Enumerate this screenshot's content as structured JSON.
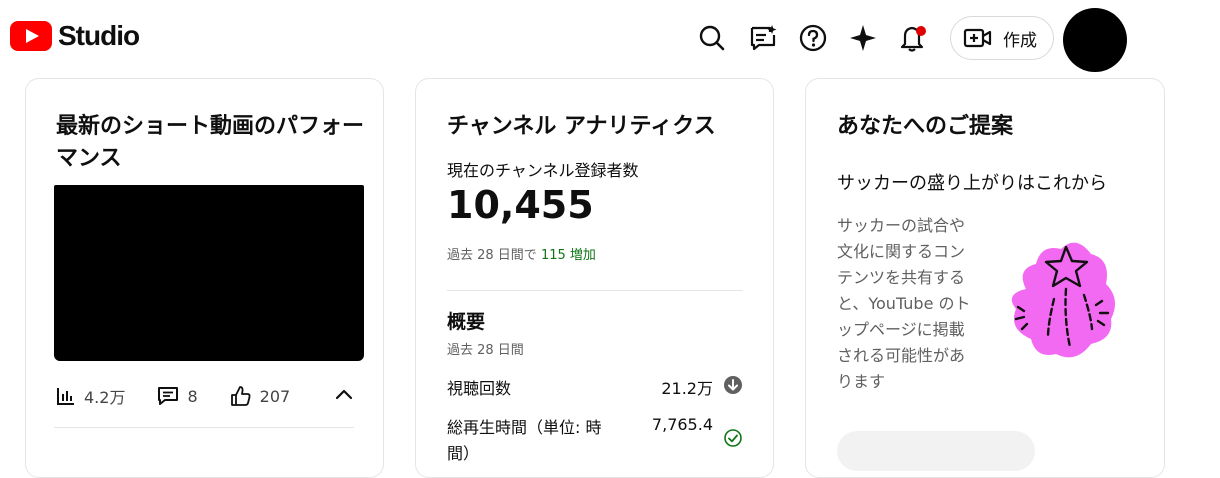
{
  "header": {
    "logo_text": "Studio",
    "create_label": "作成",
    "icons": [
      "search-icon",
      "feedback-icon",
      "help-icon",
      "sparkle-icon",
      "notifications-icon",
      "create-video-icon"
    ]
  },
  "shorts_card": {
    "title": "最新のショート動画のパフォーマンス",
    "views": "4.2万",
    "comments": "8",
    "likes": "207"
  },
  "analytics_card": {
    "title": "チャンネル アナリティクス",
    "subscribers_label": "現在のチャンネル登録者数",
    "subscribers_count": "10,455",
    "change_prefix": "過去 28 日間で",
    "change_value": "115 増加",
    "overview_title": "概要",
    "overview_period": "過去 28 日間",
    "metrics": [
      {
        "label": "視聴回数",
        "value": "21.2万",
        "status": "down"
      },
      {
        "label": "総再生時間（単位: 時間）",
        "value": "7,765.4",
        "status": "ok"
      }
    ]
  },
  "suggestion_card": {
    "title": "あなたへのご提案",
    "heading": "サッカーの盛り上がりはこれから",
    "body": "サッカーの試合や文化に関するコンテンツを共有すると、YouTube のトップページに掲載される可能性があります"
  },
  "colors": {
    "brand_red": "#ff0000",
    "increase_green": "#107516",
    "sparkle_pink": "#f26af2",
    "notification_dot": "#e00000"
  }
}
